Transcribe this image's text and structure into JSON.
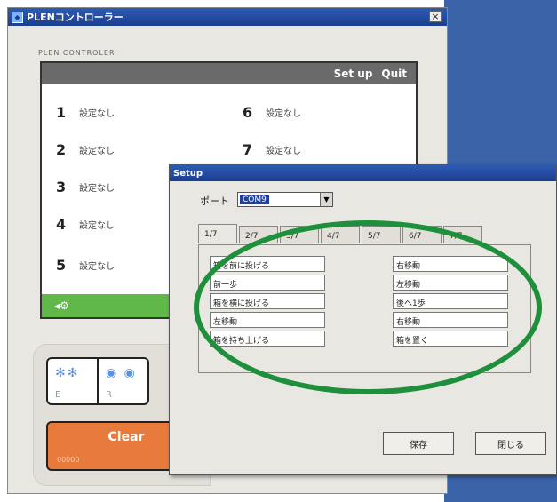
{
  "main_window": {
    "title": "PLENコントローラー",
    "close": "×",
    "app_label": "PLEN CONTROLER",
    "header_buttons": [
      "Set up",
      "Quit"
    ],
    "slots": [
      {
        "num": "1",
        "label": "設定なし"
      },
      {
        "num": "2",
        "label": "設定なし"
      },
      {
        "num": "3",
        "label": "設定なし"
      },
      {
        "num": "4",
        "label": "設定なし"
      },
      {
        "num": "5",
        "label": "設定なし"
      },
      {
        "num": "6",
        "label": "設定なし"
      },
      {
        "num": "7",
        "label": "設定なし"
      }
    ],
    "toggles": [
      {
        "icons": "✻✻",
        "letter": "E"
      },
      {
        "icons": "◉ ◉",
        "letter": "R"
      }
    ],
    "clear": {
      "label": "Clear",
      "sub": "00000"
    }
  },
  "setup": {
    "title": "Setup",
    "port_label": "ポート",
    "port_value": "COM9",
    "tabs": [
      "1/7",
      "2/7",
      "3/7",
      "4/7",
      "5/7",
      "6/7",
      "7/7"
    ],
    "left_fields": [
      "箱を前に投げる",
      "前一歩",
      "箱を横に投げる",
      "左移動",
      "箱を持ち上げる"
    ],
    "right_fields": [
      "右移動",
      "左移動",
      "後へ1歩",
      "右移動",
      "箱を置く"
    ],
    "save": "保存",
    "close": "閉じる"
  },
  "colors": {
    "accent_green": "#5fb848",
    "clear_orange": "#e87a3c",
    "titlebar": "#2d5bb3"
  }
}
